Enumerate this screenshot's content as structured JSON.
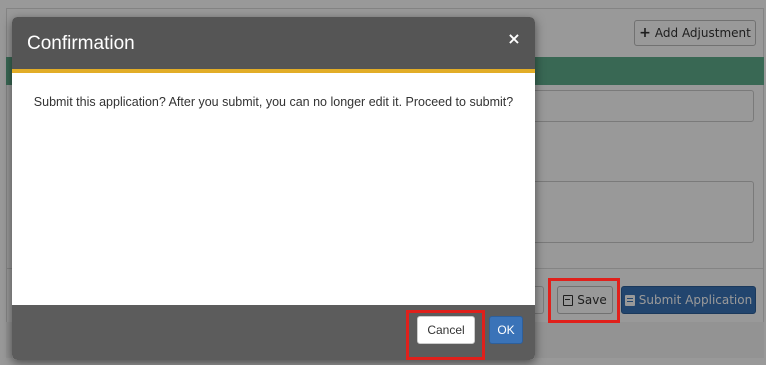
{
  "background": {
    "add_adjustment_label": "Add Adjustment",
    "save_label": "Save",
    "submit_application_label": "Submit Application"
  },
  "modal": {
    "title": "Confirmation",
    "close_glyph": "×",
    "message": "Submit this application? After you submit, you can no longer edit it. Proceed to submit?",
    "cancel_label": "Cancel",
    "ok_label": "OK"
  },
  "colors": {
    "header_bg": "#555555",
    "header_accent": "#e2ad27",
    "primary": "#3a73b8",
    "highlight": "#e0201b",
    "band": "#5fae8c"
  },
  "icons": {
    "add": "plus-icon",
    "save": "floppy-disk-icon",
    "submit": "document-icon",
    "close": "close-icon"
  }
}
